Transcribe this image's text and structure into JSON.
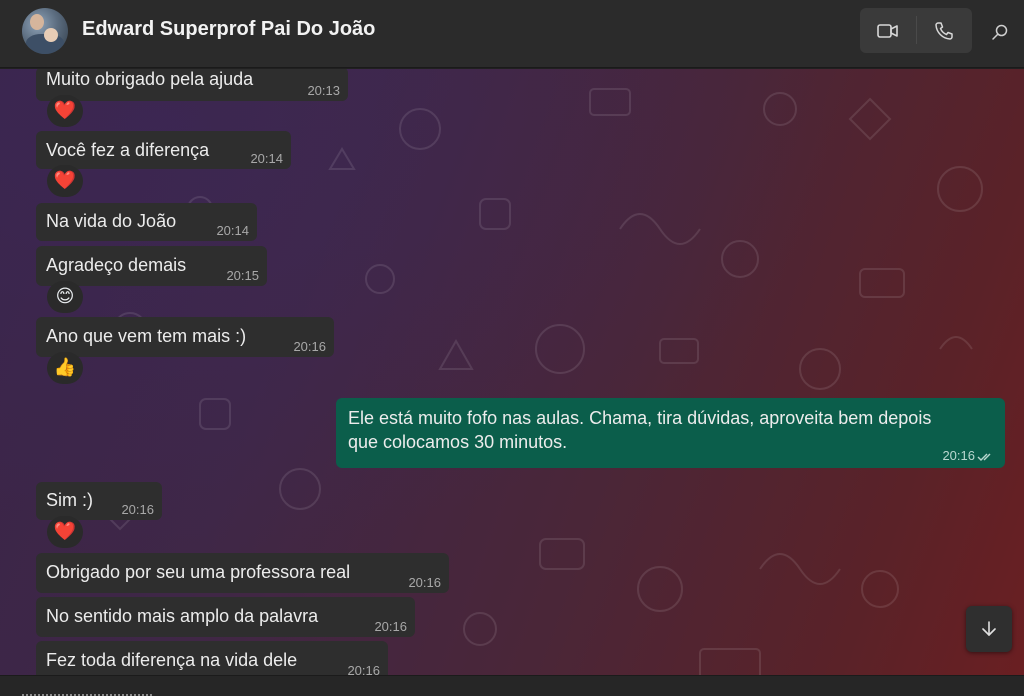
{
  "header": {
    "contact_name": "Edward Superprof Pai Do João",
    "video_call_icon": "video-camera-icon",
    "voice_call_icon": "phone-icon",
    "search_icon": "search-icon"
  },
  "messages": [
    {
      "direction": "in",
      "text": "Muito obrigado pela ajuda",
      "time": "20:13",
      "reaction": "❤️"
    },
    {
      "direction": "in",
      "text": "Você fez a diferença",
      "time": "20:14",
      "reaction": "❤️"
    },
    {
      "direction": "in",
      "text": "Na vida do João",
      "time": "20:14",
      "reaction": ""
    },
    {
      "direction": "in",
      "text": "Agradeço demais",
      "time": "20:15",
      "reaction": "😊"
    },
    {
      "direction": "in",
      "text": "Ano que vem tem mais :)",
      "time": "20:16",
      "reaction": "👍"
    },
    {
      "direction": "out",
      "text_line1": "Ele está muito fofo nas aulas. Chama, tira dúvidas, aproveita bem depois",
      "text_line2": "que colocamos 30 minutos.",
      "time": "20:16",
      "status": "read"
    },
    {
      "direction": "in",
      "text": "Sim :)",
      "time": "20:16",
      "reaction": "❤️"
    },
    {
      "direction": "in",
      "text": "Obrigado por seu uma professora real",
      "time": "20:16",
      "reaction": ""
    },
    {
      "direction": "in",
      "text": "No sentido mais amplo da palavra",
      "time": "20:16",
      "reaction": ""
    },
    {
      "direction": "in",
      "text": "Fez toda diferença na vida dele",
      "time": "20:16",
      "reaction": ""
    }
  ],
  "colors": {
    "outgoing_bubble": "#0b5e4b",
    "incoming_bubble": "#2e2e2e",
    "header_bg": "#2b2b2b"
  },
  "scroll_down_icon": "arrow-down-icon"
}
